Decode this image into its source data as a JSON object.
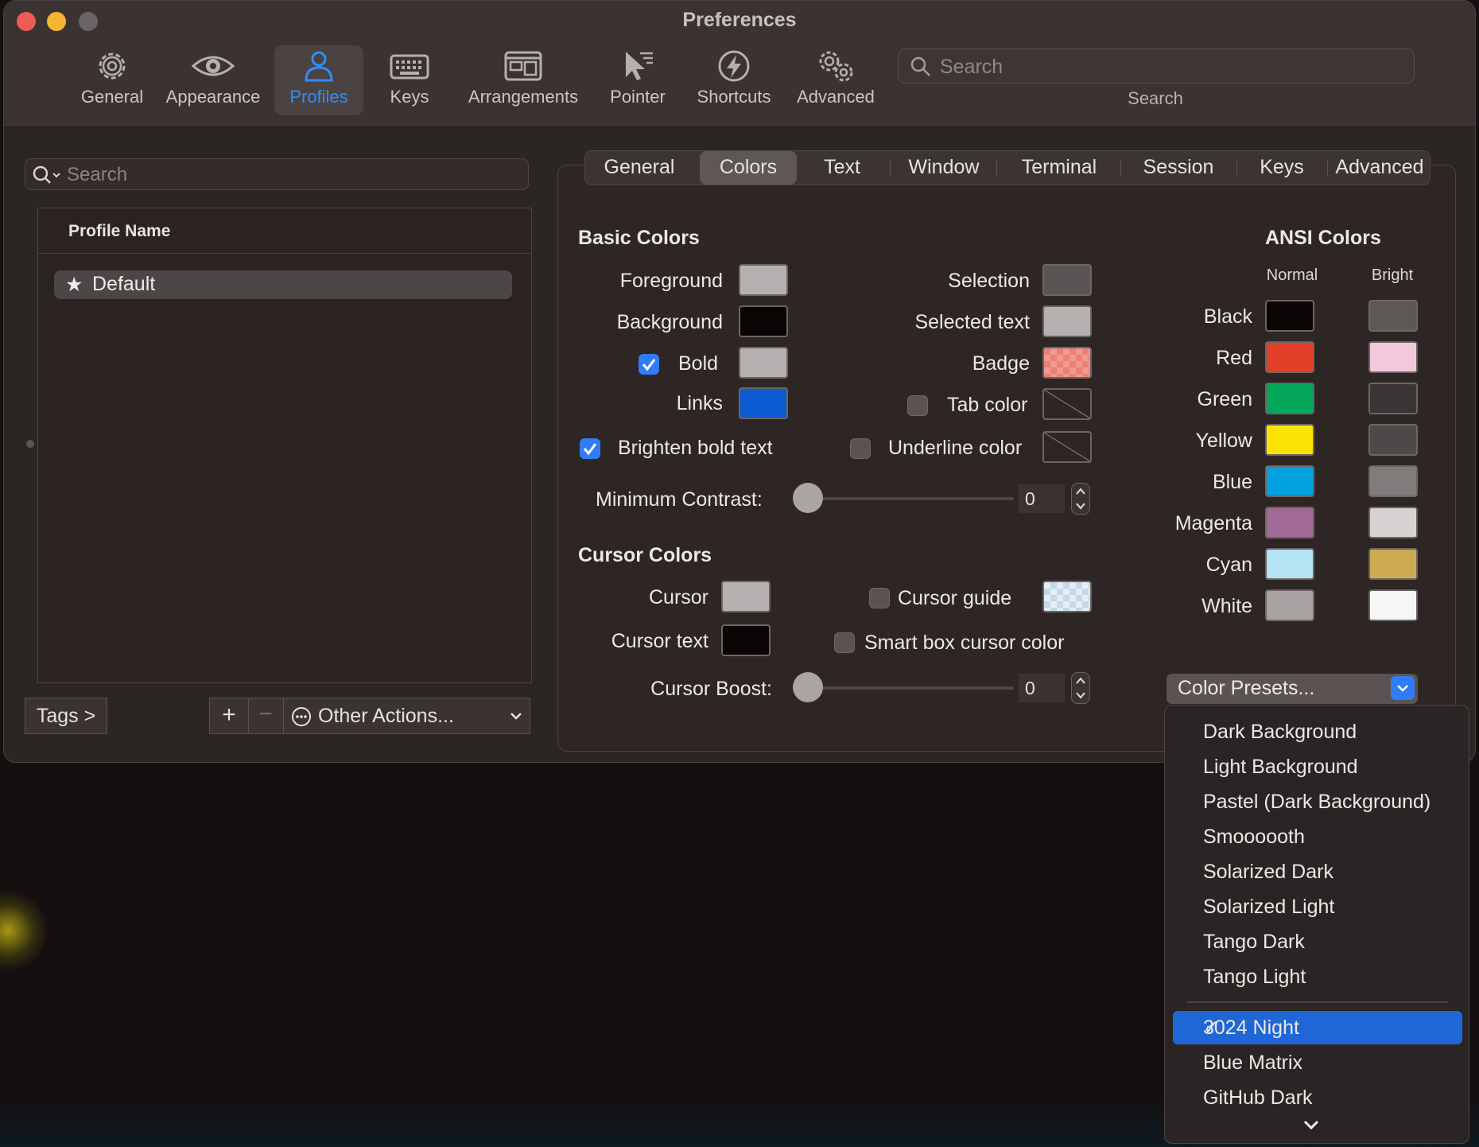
{
  "window": {
    "title": "Preferences"
  },
  "toolbar": {
    "items": [
      {
        "label": "General",
        "icon": "gear-icon"
      },
      {
        "label": "Appearance",
        "icon": "eye-icon"
      },
      {
        "label": "Profiles",
        "icon": "person-icon"
      },
      {
        "label": "Keys",
        "icon": "keyboard-icon"
      },
      {
        "label": "Arrangements",
        "icon": "windows-icon"
      },
      {
        "label": "Pointer",
        "icon": "cursor-icon"
      },
      {
        "label": "Shortcuts",
        "icon": "bolt-icon"
      },
      {
        "label": "Advanced",
        "icon": "gears-icon"
      }
    ],
    "active": "Profiles",
    "search_placeholder": "Search",
    "search_label": "Search"
  },
  "sidebar": {
    "search_placeholder": "Search",
    "column_header": "Profile Name",
    "profiles": [
      {
        "name": "Default",
        "default": true
      }
    ],
    "tags_label": "Tags >",
    "add_label": "+",
    "remove_label": "−",
    "other_actions_label": "Other Actions..."
  },
  "tabs": {
    "items": [
      "General",
      "Colors",
      "Text",
      "Window",
      "Terminal",
      "Session",
      "Keys",
      "Advanced"
    ],
    "active": "Colors"
  },
  "basic": {
    "title": "Basic Colors",
    "foreground": {
      "label": "Foreground",
      "color": "#b5b1b0"
    },
    "background": {
      "label": "Background",
      "color": "#090605"
    },
    "bold": {
      "label": "Bold",
      "color": "#b5b1b0",
      "checked": true
    },
    "links": {
      "label": "Links",
      "color": "#0c5bd0"
    },
    "brighten": {
      "label": "Brighten bold text",
      "checked": true
    },
    "selection": {
      "label": "Selection",
      "color": "#5a5454"
    },
    "selected_text": {
      "label": "Selected text",
      "color": "#b5b1b0"
    },
    "badge": {
      "label": "Badge",
      "color": "#f07f73"
    },
    "tab_color": {
      "label": "Tab color",
      "checked": false
    },
    "underline_color": {
      "label": "Underline color",
      "checked": false
    },
    "min_contrast": {
      "label": "Minimum Contrast:",
      "value": "0",
      "fraction": 0
    }
  },
  "cursor": {
    "title": "Cursor Colors",
    "cursor": {
      "label": "Cursor",
      "color": "#b5b1b0"
    },
    "cursor_text": {
      "label": "Cursor text",
      "color": "#090605"
    },
    "cursor_guide": {
      "label": "Cursor guide",
      "checked": false
    },
    "smart_box": {
      "label": "Smart box cursor color",
      "checked": false
    },
    "boost": {
      "label": "Cursor Boost:",
      "value": "0",
      "fraction": 0
    }
  },
  "ansi": {
    "title": "ANSI Colors",
    "normal_label": "Normal",
    "bright_label": "Bright",
    "rows": [
      {
        "name": "Black",
        "normal": "#090605",
        "bright": "#5c5856"
      },
      {
        "name": "Red",
        "normal": "#e3402a",
        "bright": "#f2c8dc"
      },
      {
        "name": "Green",
        "normal": "#04a75a",
        "bright": "#3a3534"
      },
      {
        "name": "Yellow",
        "normal": "#fbe404",
        "bright": "#4d4948"
      },
      {
        "name": "Blue",
        "normal": "#01a1df",
        "bright": "#807c7b"
      },
      {
        "name": "Magenta",
        "normal": "#a16a95",
        "bright": "#d6d3d2"
      },
      {
        "name": "Cyan",
        "normal": "#b5e4f4",
        "bright": "#cdab53"
      },
      {
        "name": "White",
        "normal": "#a5a2a1",
        "bright": "#f6f6f6"
      }
    ]
  },
  "presets": {
    "button_label": "Color Presets...",
    "items": [
      "Dark Background",
      "Light Background",
      "Pastel (Dark Background)",
      "Smoooooth",
      "Solarized Dark",
      "Solarized Light",
      "Tango Dark",
      "Tango Light"
    ],
    "custom_items": [
      "3024 Night",
      "Blue Matrix",
      "GitHub Dark"
    ],
    "selected": "3024 Night",
    "checkmark": "✓"
  }
}
